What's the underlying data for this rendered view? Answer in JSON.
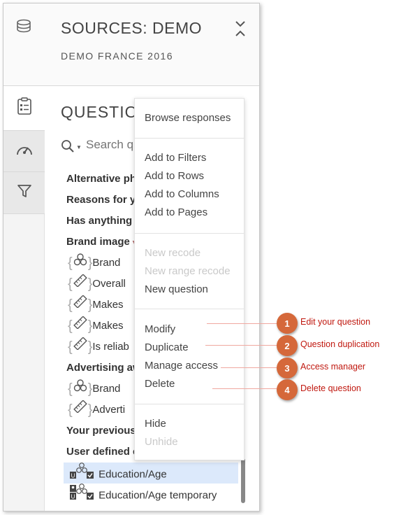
{
  "header": {
    "title": "SOURCES: DEMO",
    "subtitle": "DEMO FRANCE 2016",
    "icon": "database-icon"
  },
  "rail": {
    "items": [
      {
        "name": "questions",
        "icon": "clipboard-list-icon"
      },
      {
        "name": "dashboard",
        "icon": "speedometer-icon"
      },
      {
        "name": "filters",
        "icon": "filter-icon"
      }
    ]
  },
  "questions": {
    "title": "QUESTIO",
    "search_placeholder": "Search q",
    "rows": [
      {
        "text": "Alternative ph",
        "kind": "category"
      },
      {
        "text": "Reasons for yo",
        "kind": "category"
      },
      {
        "text": "Has anything g",
        "kind": "category"
      },
      {
        "text": "Brand image",
        "kind": "category"
      },
      {
        "text": "Brand",
        "kind": "question",
        "icon": "circles-icon"
      },
      {
        "text": "Overall",
        "kind": "question",
        "icon": "ruler-icon"
      },
      {
        "text": "Makes",
        "kind": "question",
        "icon": "ruler-icon"
      },
      {
        "text": "Makes",
        "kind": "question",
        "icon": "ruler-icon"
      },
      {
        "text": "Is reliab",
        "kind": "question",
        "icon": "ruler-icon"
      },
      {
        "text": "Advertising aw",
        "kind": "category"
      },
      {
        "text": "Brand",
        "kind": "question",
        "icon": "circles-icon"
      },
      {
        "text": "Adverti",
        "kind": "question",
        "icon": "ruler-icon"
      },
      {
        "text": "Your previous",
        "kind": "category"
      },
      {
        "text": "User defined c",
        "kind": "category"
      },
      {
        "text": "Education/Age",
        "kind": "user",
        "selected": true
      },
      {
        "text": "Education/Age temporary",
        "kind": "user"
      }
    ]
  },
  "menu": {
    "groups": [
      [
        {
          "label": "Browse responses",
          "enabled": true
        }
      ],
      [
        {
          "label": "Add to Filters",
          "enabled": true
        },
        {
          "label": "Add to Rows",
          "enabled": true
        },
        {
          "label": "Add to Columns",
          "enabled": true
        },
        {
          "label": "Add to Pages",
          "enabled": true
        }
      ],
      [
        {
          "label": "New recode",
          "enabled": false
        },
        {
          "label": "New range recode",
          "enabled": false
        },
        {
          "label": "New question",
          "enabled": true
        }
      ],
      [
        {
          "label": "Modify",
          "enabled": true
        },
        {
          "label": "Duplicate",
          "enabled": true
        },
        {
          "label": "Manage access",
          "enabled": true
        },
        {
          "label": "Delete",
          "enabled": true
        }
      ],
      [
        {
          "label": "Hide",
          "enabled": true
        },
        {
          "label": "Unhide",
          "enabled": false
        }
      ]
    ]
  },
  "callouts": [
    {
      "number": "1",
      "label": "Edit your question"
    },
    {
      "number": "2",
      "label": "Question duplication"
    },
    {
      "number": "3",
      "label": "Access manager"
    },
    {
      "number": "4",
      "label": "Delete question"
    }
  ],
  "colors": {
    "badge": "#d5683a",
    "callout_text": "#c0180f",
    "selected_row": "#dce9fb"
  }
}
